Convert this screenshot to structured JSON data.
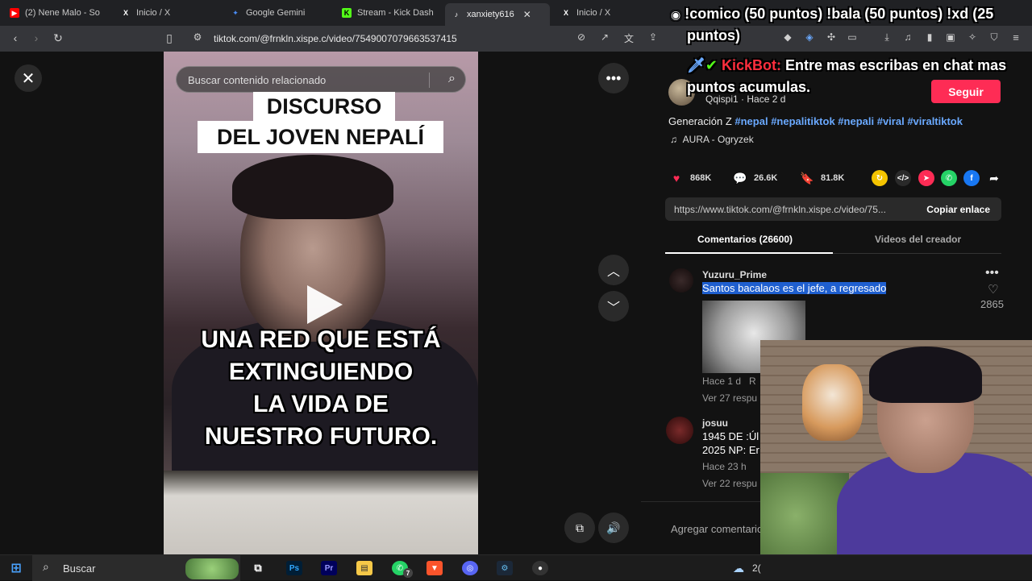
{
  "browser": {
    "tabs": [
      {
        "label": "(2) Nene Malo - So",
        "icon": "youtube-icon",
        "color": "#ff0000"
      },
      {
        "label": "Inicio / X",
        "icon": "x-icon",
        "color": "#ffffff"
      },
      {
        "label": "Google Gemini",
        "icon": "gemini-icon",
        "color": "#4a8df8"
      },
      {
        "label": "Stream - Kick Dash",
        "icon": "kick-icon",
        "color": "#53fc18"
      },
      {
        "label": "xanxiety616",
        "icon": "tiktok-icon",
        "color": "#ffffff"
      },
      {
        "label": "Inicio / X",
        "icon": "x-icon",
        "color": "#ffffff"
      }
    ],
    "url": "tiktok.com/@frnkln.xispe.c/video/7549007079663537415"
  },
  "overlay": {
    "line1": "!comico (50 puntos) !bala (50 puntos) !xd (25",
    "line2": "puntos)",
    "bot_name": "KickBot:",
    "bot_line1": "Entre mas escribas en chat mas",
    "bot_line2": "puntos acumulas."
  },
  "video": {
    "search_placeholder": "Buscar contenido relacionado",
    "caption_top_1": "DISCURSO",
    "caption_top_2": "DEL JOVEN NEPALÍ",
    "caption_lines": [
      "UNA RED QUE ESTÁ",
      "EXTINGUIENDO",
      "LA VIDA DE",
      "NUESTRO FUTURO."
    ]
  },
  "post": {
    "author_handle": "Qqispi1",
    "time_ago": "Hace 2 d",
    "follow_label": "Seguir",
    "description": "Generación Z",
    "hashtags": [
      "#nepal",
      "#nepalitiktok",
      "#nepali",
      "#viral",
      "#viraltiktok"
    ],
    "music": "AURA - Ogryzek",
    "likes": "868K",
    "comments": "26.6K",
    "saves": "81.8K",
    "link": "https://www.tiktok.com/@frnkln.xispe.c/video/75...",
    "copy_label": "Copiar enlace",
    "tab_comments": "Comentarios (26600)",
    "tab_creator": "Videos del creador"
  },
  "comments": [
    {
      "user": "Yuzuru_Prime",
      "text": "Santos bacalaos es el jefe, a regresado",
      "time": "Hace 1 d",
      "reply_short": "R",
      "likes": "2865",
      "replies": "Ver 27 respu"
    },
    {
      "user": "josuu",
      "line1": "1945 DE :Úl",
      "line2": "2025 NP: Er",
      "time": "Hace 23 h",
      "replies": "Ver 22 respu"
    }
  ],
  "add_comment_placeholder": "Agregar comentario",
  "taskbar": {
    "search_placeholder": "Buscar",
    "whatsapp_badge": "7",
    "tray_text": "2("
  }
}
